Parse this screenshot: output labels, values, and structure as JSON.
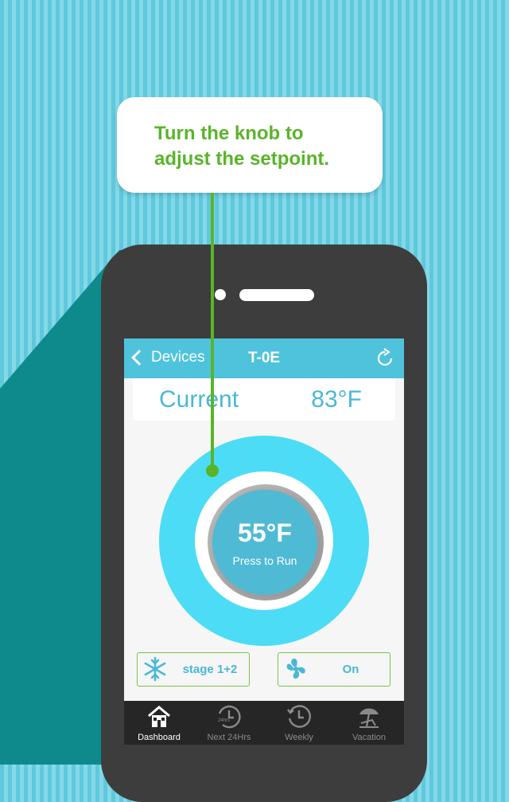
{
  "callout": {
    "text": "Turn the knob to\nadjust the setpoint."
  },
  "navbar": {
    "back_label": "Devices",
    "title": "T-0E",
    "refresh_icon": "refresh-icon"
  },
  "current": {
    "label": "Current",
    "value": "83°F"
  },
  "knob": {
    "setpoint": "55°F",
    "action": "Press to Run"
  },
  "modes": [
    {
      "icon": "snowflake-icon",
      "label": "stage 1+2"
    },
    {
      "icon": "fan-icon",
      "label": "On"
    }
  ],
  "tabs": [
    {
      "label": "Dashboard",
      "icon": "home-icon",
      "active": true
    },
    {
      "label": "Next 24Hrs",
      "icon": "clock-24-icon",
      "active": false
    },
    {
      "label": "Weekly",
      "icon": "clock-icon",
      "active": false
    },
    {
      "label": "Vacation",
      "icon": "beach-umbrella-icon",
      "active": false
    }
  ],
  "colors": {
    "accent": "#4fc3dc",
    "knob": "#4ddcf5",
    "callout_text": "#5ab42a",
    "background_teal": "#0e8a8c"
  }
}
